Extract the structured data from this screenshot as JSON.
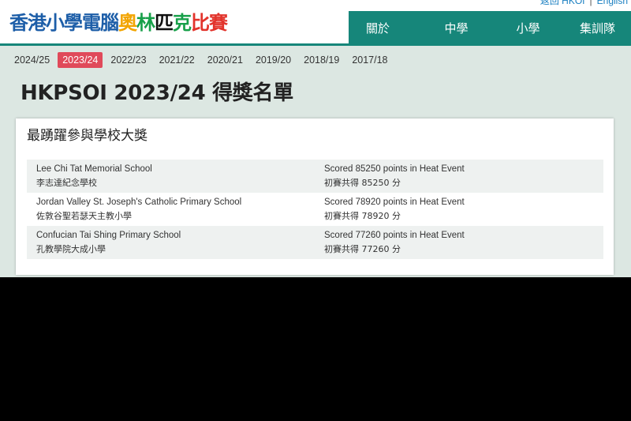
{
  "header": {
    "top_links": {
      "back": "返回 HKOI",
      "separator": "|",
      "english": "English"
    },
    "logo_parts": [
      {
        "text": "香港小學電腦",
        "color": "#1d5ea8"
      },
      {
        "text": "奧",
        "color": "#f2a400"
      },
      {
        "text": "林",
        "color": "#18a04a"
      },
      {
        "text": "匹",
        "color": "#111111"
      },
      {
        "text": "克",
        "color": "#18a04a"
      },
      {
        "text": "比賽",
        "color": "#e2332b"
      }
    ],
    "nav": [
      "關於",
      "中學",
      "小學",
      "集訓隊"
    ]
  },
  "years": {
    "items": [
      "2024/25",
      "2023/24",
      "2022/23",
      "2021/22",
      "2020/21",
      "2019/20",
      "2018/19",
      "2017/18"
    ],
    "active": "2023/24"
  },
  "page_title": "HKPSOI 2023/24 得獎名單",
  "award": {
    "title": "最踴躍參與學校大獎",
    "rows": [
      {
        "school_en": "Lee Chi Tat Memorial School",
        "school_zh": "李志達紀念學校",
        "score_en": "Scored 85250 points in Heat Event",
        "score_zh": "初賽共得 85250 分"
      },
      {
        "school_en": "Jordan Valley St. Joseph's Catholic Primary School",
        "school_zh": "佐敦谷聖若瑟天主教小學",
        "score_en": "Scored 78920 points in Heat Event",
        "score_zh": "初賽共得 78920 分"
      },
      {
        "school_en": "Confucian Tai Shing Primary School",
        "school_zh": "孔教學院大成小學",
        "score_en": "Scored 77260 points in Heat Event",
        "score_zh": "初賽共得 77260 分"
      }
    ]
  },
  "colors": {
    "nav_bg": "#16867a",
    "active_year": "#e04a5a",
    "page_bg": "#dce7e2",
    "link": "#1a7fc1"
  }
}
